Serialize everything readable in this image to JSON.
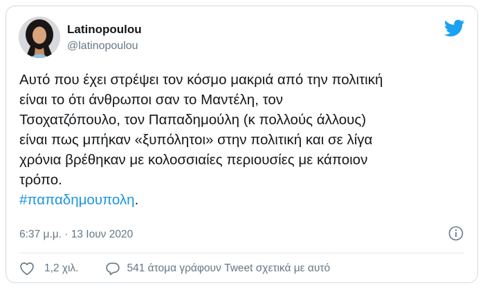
{
  "user": {
    "display_name": "Latinopoulou",
    "handle": "@latinopoulou",
    "avatar_icon": "profile-avatar"
  },
  "tweet": {
    "text": "Αυτό που έχει στρέψει τον κόσμο μακριά από την πολιτική\nείναι το ότι άνθρωποι σαν το Μαντέλη, τον\nΤσοχατζόπουλο, τον Παπαδημούλη (κ πολλούς άλλους)\nείναι πως μπήκαν «ξυπόλητοι» στην πολιτική και σε λίγα\nχρόνια βρέθηκαν με κολοσσιαίες περιουσίες με κάποιον\nτρόπο.\n",
    "hashtag": "#παπαδημουπολη",
    "hashtag_suffix": ".",
    "timestamp": "6:37 μ.μ. · 13 Ιουν 2020"
  },
  "actions": {
    "like_count": "1,2 χιλ.",
    "reply_text": "541 άτομα γράφουν Tweet σχετικά με αυτό"
  },
  "icons": {
    "brand": "twitter-bird-icon",
    "info": "info-icon",
    "like": "heart-icon",
    "reply": "comment-icon"
  },
  "colors": {
    "accent": "#1da1f2",
    "hashtag": "#1b95e0",
    "secondary_text": "#657786",
    "border": "#cfd9de"
  }
}
